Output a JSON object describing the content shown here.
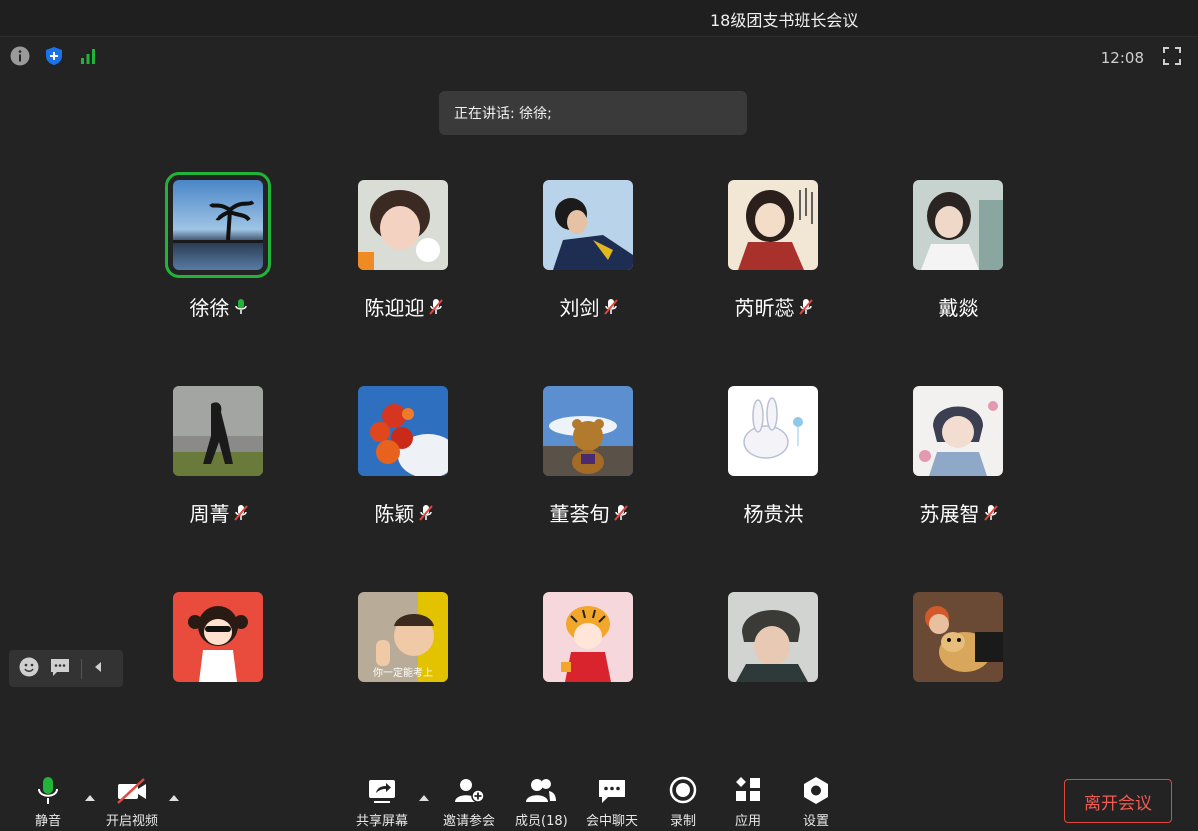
{
  "window": {
    "title": "18级团支书班长会议"
  },
  "status": {
    "clock": "12:08"
  },
  "speaking": {
    "label": "正在讲话: 徐徐;"
  },
  "participants": [
    {
      "name": "徐徐",
      "mic": "on"
    },
    {
      "name": "陈迎迎",
      "mic": "muted"
    },
    {
      "name": "刘剑",
      "mic": "muted"
    },
    {
      "name": "芮昕蕊",
      "mic": "muted"
    },
    {
      "name": "戴燚",
      "mic": "none"
    },
    {
      "name": "周菁",
      "mic": "muted"
    },
    {
      "name": "陈颖",
      "mic": "muted"
    },
    {
      "name": "董荟旬",
      "mic": "muted"
    },
    {
      "name": "杨贵洪",
      "mic": "none"
    },
    {
      "name": "苏展智",
      "mic": "muted"
    }
  ],
  "tile_caption": "你一定能考上",
  "toolbar": {
    "mute": "静音",
    "video": "开启视频",
    "share": "共享屏幕",
    "invite": "邀请参会",
    "members": "成员(18)",
    "chat": "会中聊天",
    "record": "录制",
    "apps": "应用",
    "settings": "设置",
    "leave": "离开会议"
  },
  "colors": {
    "background": "#232323",
    "active_speaker": "#21b33a",
    "leave": "#e0473f",
    "muted": "#e0473f",
    "security": "#1a73e8",
    "signal": "#21b33a"
  }
}
